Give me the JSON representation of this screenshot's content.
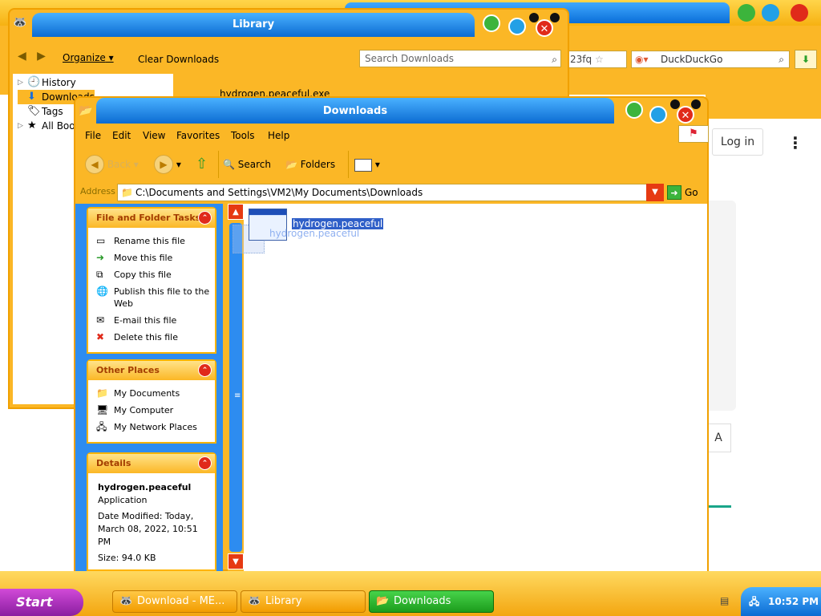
{
  "browser": {
    "url_fragment": "23fq",
    "search_engine": "DuckDuckGo",
    "login_label": "Log in",
    "more_label": "⋮",
    "side_button_label": "A"
  },
  "library": {
    "title": "Library",
    "organize_label": "Organize",
    "clear_label": "Clear Downloads",
    "search_placeholder": "Search Downloads",
    "tree": [
      {
        "label": "History",
        "icon": "clock-icon",
        "glyph": "🕘"
      },
      {
        "label": "Downloads",
        "icon": "download-arrow-icon",
        "glyph": "⬇"
      },
      {
        "label": "Tags",
        "icon": "tag-icon",
        "glyph": "🏷"
      },
      {
        "label": "All Bool",
        "icon": "star-folder-icon",
        "glyph": "★"
      }
    ],
    "download_entry": "hydrogen.peaceful.exe"
  },
  "explorer": {
    "title": "Downloads",
    "menu": [
      "File",
      "Edit",
      "View",
      "Favorites",
      "Tools",
      "Help"
    ],
    "toolbar": {
      "back": "Back",
      "search": "Search",
      "folders": "Folders"
    },
    "address_label": "Address",
    "address_value": "C:\\Documents and Settings\\VM2\\My Documents\\Downloads",
    "go_label": "Go",
    "file_tasks": {
      "title": "File and Folder Tasks",
      "items": [
        {
          "label": "Rename this file",
          "glyph": "▭"
        },
        {
          "label": "Move this file",
          "glyph": "➜"
        },
        {
          "label": "Copy this file",
          "glyph": "⧉"
        },
        {
          "label": "Publish this file to the Web",
          "glyph": "🌐"
        },
        {
          "label": "E-mail this file",
          "glyph": "✉"
        },
        {
          "label": "Delete this file",
          "glyph": "✖"
        }
      ]
    },
    "other_places": {
      "title": "Other Places",
      "items": [
        {
          "label": "My Documents",
          "glyph": "📁"
        },
        {
          "label": "My Computer",
          "glyph": "🖥"
        },
        {
          "label": "My Network Places",
          "glyph": "🖧"
        }
      ]
    },
    "details": {
      "title": "Details",
      "name": "hydrogen.peaceful",
      "type": "Application",
      "modified": "Date Modified: Today, March 08, 2022, 10:51 PM",
      "size": "Size: 94.0 KB"
    },
    "file": {
      "name": "hydrogen.peaceful",
      "ghost_name": "hydrogen.peaceful"
    }
  },
  "taskbar": {
    "start": "Start",
    "buttons": [
      {
        "label": "Download - ME...",
        "active": false
      },
      {
        "label": "Library",
        "active": false
      },
      {
        "label": "Downloads",
        "active": true
      }
    ],
    "clock": "10:52 PM"
  }
}
